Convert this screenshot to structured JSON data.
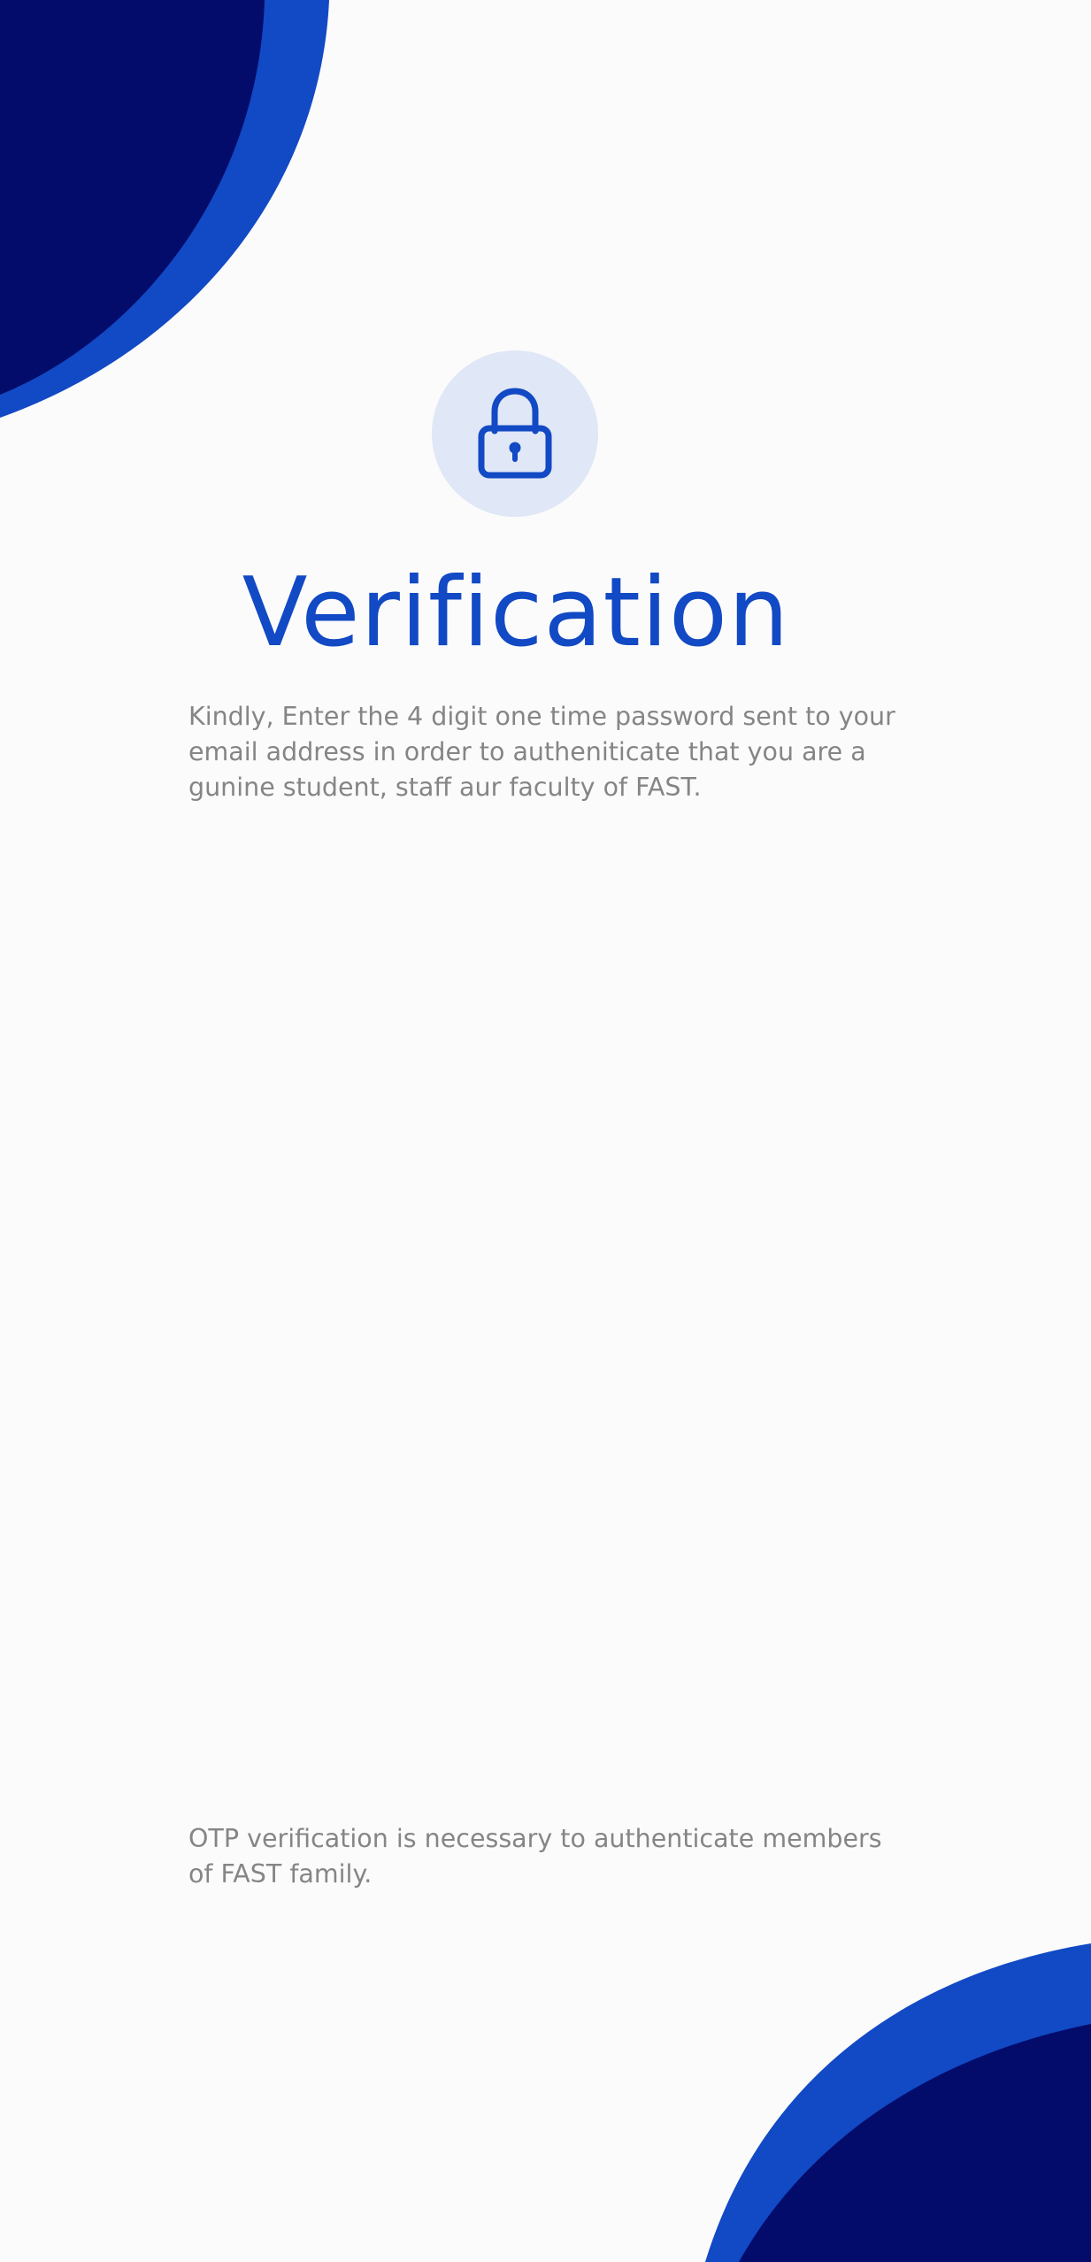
{
  "verification": {
    "icon": "lock-icon",
    "title": "Verification",
    "instructions": "Kindly, Enter the 4 digit one time password sent to your email address in order to autheniticate that you are a gunine student, staff aur faculty of FAST.",
    "footnote": "OTP verification is necessary to authenticate members of FAST family."
  },
  "colors": {
    "accent": "#1249c4",
    "dark_navy": "#030c6b",
    "badge_background": "#e0e7f6",
    "muted_text": "#858585",
    "page_background": "#fbfbfb"
  }
}
